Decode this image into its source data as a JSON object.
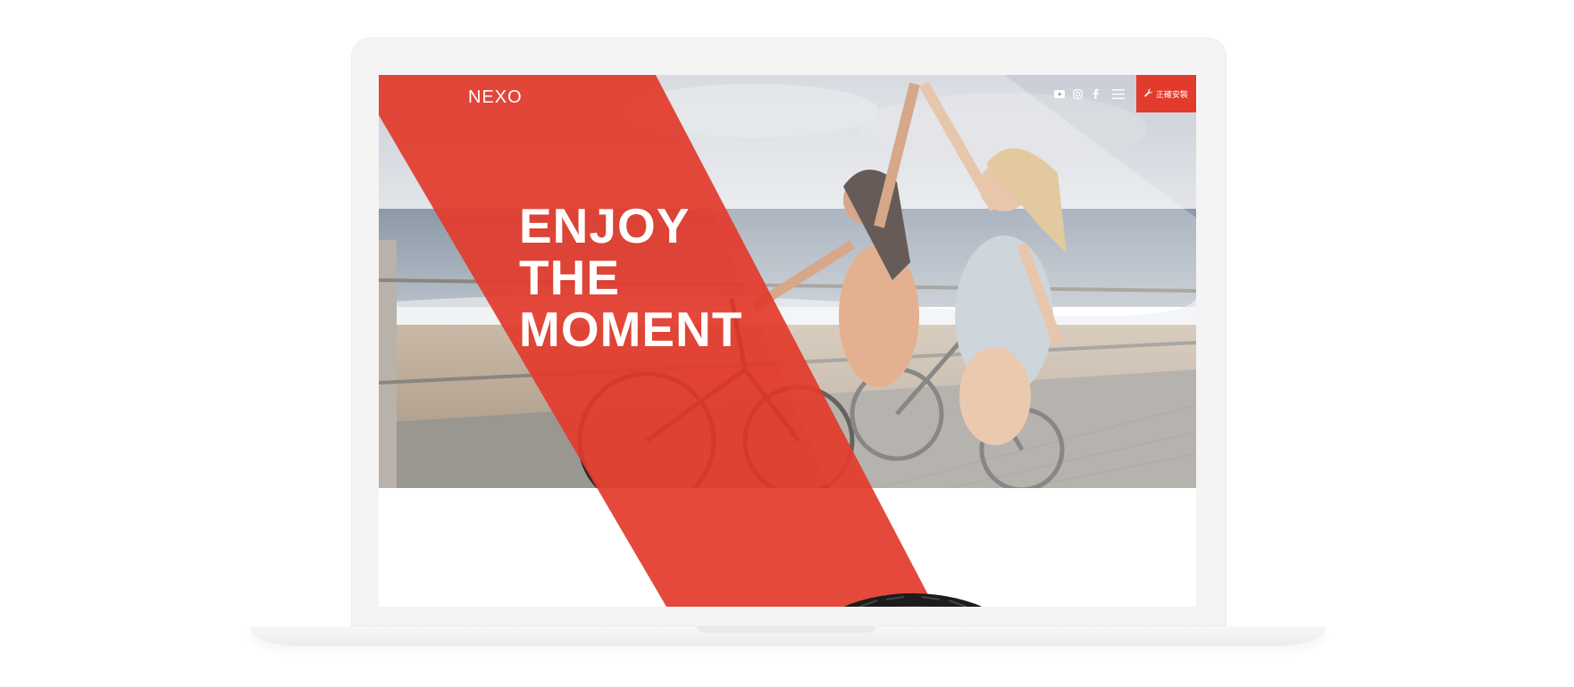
{
  "brand": {
    "logo_text": "NEXO",
    "accent_color": "#e23b2c"
  },
  "header": {
    "social_icons": [
      "youtube-icon",
      "instagram-icon",
      "facebook-icon",
      "menu-icon"
    ],
    "install_button_label": "正確安裝",
    "install_button_icon": "wrench-icon"
  },
  "hero": {
    "headline_lines": [
      "ENJOY",
      "THE",
      "MOMENT"
    ]
  }
}
